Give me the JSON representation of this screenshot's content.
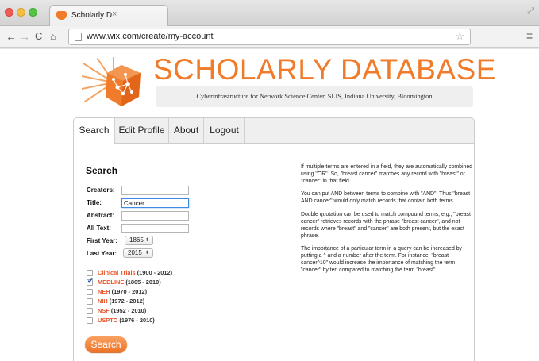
{
  "browser": {
    "tab_title": "Scholarly D",
    "tab_close": "×",
    "url": "www.wix.com/create/my-account",
    "icons": {
      "back": "arrow-left-icon",
      "forward": "arrow-right-icon",
      "reload": "reload-icon",
      "home": "home-icon",
      "star": "star-icon",
      "menu": "hamburger-menu-icon"
    }
  },
  "site": {
    "title": "SCHOLARLY DATABASE",
    "subtitle": "Cyberinfrastructure for Network Science Center, SLIS, Indiana University, Bloomington",
    "brand_color": "#f07b2a"
  },
  "tabs": [
    {
      "label": "Search",
      "active": true
    },
    {
      "label": "Edit Profile",
      "active": false
    },
    {
      "label": "About",
      "active": false
    },
    {
      "label": "Logout",
      "active": false
    }
  ],
  "search": {
    "heading": "Search",
    "fields": [
      {
        "label": "Creators:",
        "value": ""
      },
      {
        "label": "Title:",
        "value": "Cancer"
      },
      {
        "label": "Abstract:",
        "value": ""
      },
      {
        "label": "All Text:",
        "value": ""
      }
    ],
    "first_year": {
      "label": "First Year:",
      "value": "1865"
    },
    "last_year": {
      "label": "Last Year:",
      "value": "2015"
    },
    "databases": [
      {
        "name": "Clinical Trials",
        "range": "(1900 - 2012)",
        "checked": false
      },
      {
        "name": "MEDLINE",
        "range": "(1865 - 2010)",
        "checked": true
      },
      {
        "name": "NEH",
        "range": "(1970 - 2012)",
        "checked": false
      },
      {
        "name": "NIH",
        "range": "(1972 - 2012)",
        "checked": false
      },
      {
        "name": "NSF",
        "range": "(1952 - 2010)",
        "checked": false
      },
      {
        "name": "USPTO",
        "range": "(1976 - 2010)",
        "checked": false
      }
    ],
    "button_label": "Search"
  },
  "help": [
    "If multiple terms are entered in a field, they are automatically combined using \"OR\". So, \"breast cancer\" matches any record with \"breast\" or \"cancer\" in that field.",
    "You can put AND between terms to combine with \"AND\". Thus \"breast AND cancer\" would only match records that contain both terms.",
    "Double quotation can be used to match compound terms, e.g., \"breast cancer\" retrieves records with the phrase \"breast cancer\", and not records where \"breast\" and \"cancer\" are both present, but the exact phrase.",
    "The importance of a particular term in a query can be increased by putting a ^ and a number after the term. For instance, \"breast cancer^10\" would increase the importance of matching the term \"cancer\" by ten compared to matching the term \"breast\"."
  ]
}
